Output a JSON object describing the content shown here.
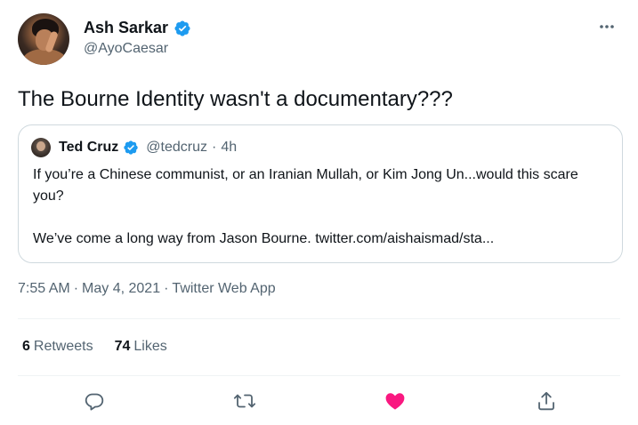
{
  "author": {
    "display_name": "Ash Sarkar",
    "handle": "@AyoCaesar",
    "verified": true
  },
  "tweet": {
    "text": "The Bourne Identity wasn't a documentary???",
    "time": "7:55 AM",
    "separator": "·",
    "date": "May 4, 2021",
    "source": "Twitter Web App"
  },
  "quoted_tweet": {
    "display_name": "Ted Cruz",
    "handle": "@tedcruz",
    "separator": "·",
    "age": "4h",
    "paragraph_1": "If you’re a Chinese communist, or an Iranian Mullah, or Kim Jong Un...would this scare you?",
    "paragraph_2": "We’ve come a long way from Jason Bourne. twitter.com/aishaismad/sta..."
  },
  "stats": {
    "retweets_count": "6",
    "retweets_label": "Retweets",
    "likes_count": "74",
    "likes_label": "Likes"
  },
  "icons": {
    "more": "more-dots-icon",
    "verified": "verified-badge-icon",
    "reply": "reply-icon",
    "retweet": "retweet-icon",
    "like": "heart-icon",
    "share": "share-icon"
  },
  "colors": {
    "verified": "#1d9bf0",
    "like_active": "#f91880",
    "muted_text": "#536471",
    "icon_gray": "#536471",
    "border": "#cfd9de"
  }
}
